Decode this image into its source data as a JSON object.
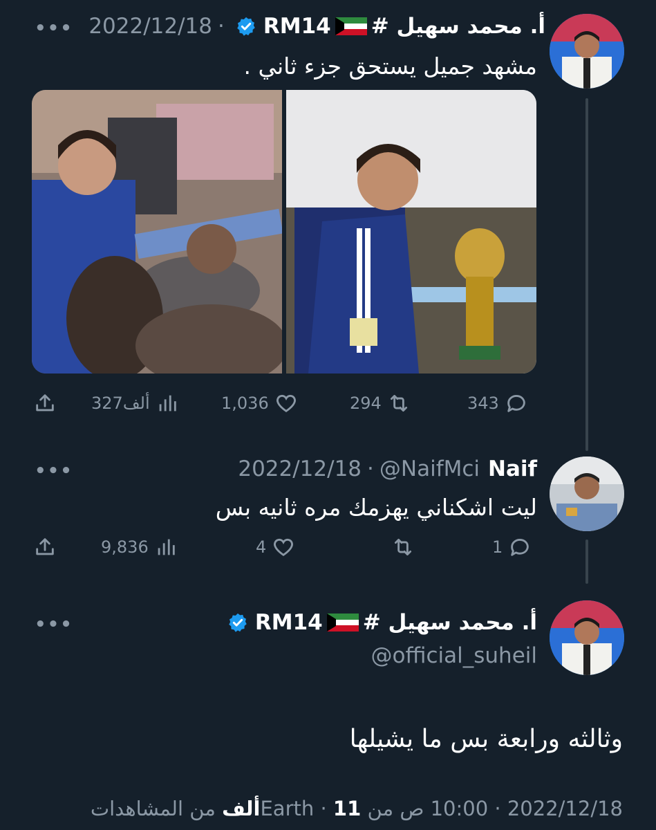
{
  "tweet1": {
    "author_name": "أ. محمد سهيل #",
    "author_tag": "RM14",
    "date": "2022/12/18",
    "separator": "·",
    "more": "•••",
    "text": "مشهد جميل يستحق جزء ثاني .",
    "stats": {
      "replies": "343",
      "retweets": "294",
      "likes": "1,036",
      "views": "327ألف"
    }
  },
  "tweet2": {
    "author_name": "Naif",
    "handle": "@NaifMci",
    "date": "2022/12/18",
    "separator": "·",
    "more": "•••",
    "text": "ليت اشكناني يهزمك مره ثانيه بس",
    "stats": {
      "replies": "1",
      "likes": "4",
      "views": "9,836"
    }
  },
  "tweet3": {
    "author_name": "أ. محمد سهيل #",
    "author_tag": "RM14",
    "handle": "@official_suheil",
    "more": "•••",
    "text": "وثالثه ورابعة بس ما يشيلها",
    "footer": {
      "date": "2022/12/18",
      "time": "10:00 ص من Earth",
      "views_count": "11ألف",
      "views_label": "من المشاهدات",
      "separator": "·"
    }
  },
  "colors": {
    "background": "#15202b",
    "text_primary": "#ffffff",
    "text_secondary": "#8b98a5",
    "verified_blue": "#1d9bf0",
    "thread_line": "#38444d"
  }
}
